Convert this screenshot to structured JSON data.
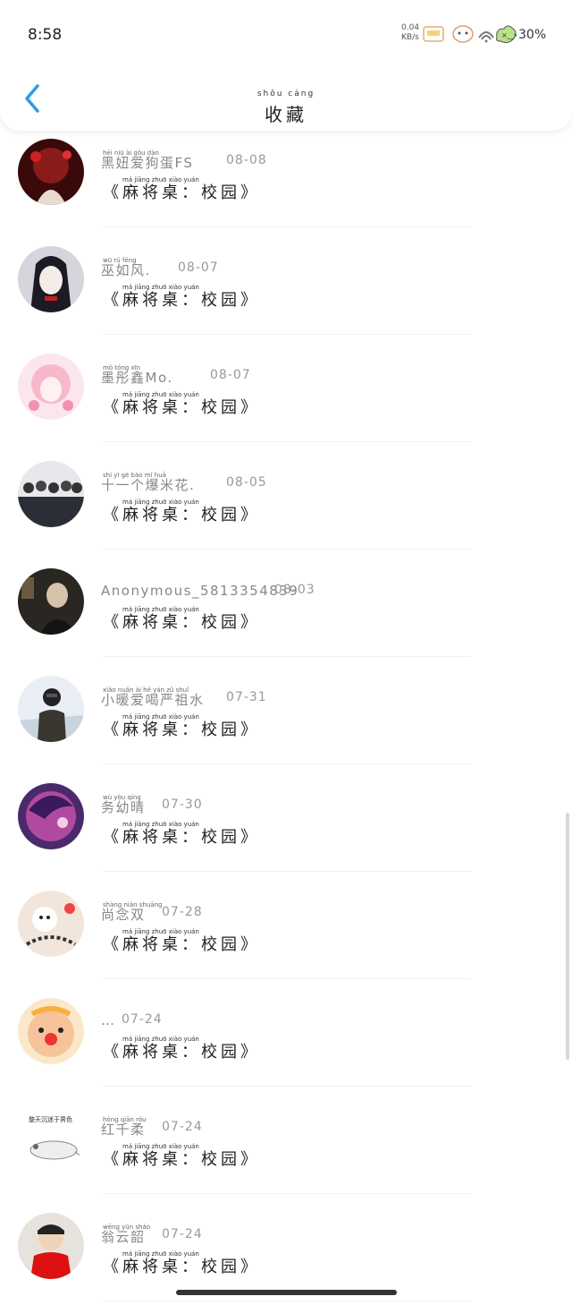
{
  "status_bar": {
    "time": "8:58",
    "net_speed_value": "0.04",
    "net_speed_unit": "KB/s",
    "battery": "30%"
  },
  "header": {
    "title": "收藏",
    "title_pinyin": "shōu cáng"
  },
  "items": [
    {
      "name": "黑妞爱狗蛋FS",
      "name_pinyin": "hēi niū ài gǒu dàn",
      "date": "08-08",
      "content": "《麻将桌：校园》"
    },
    {
      "name": "巫如风.",
      "name_pinyin": "wū rú fēng",
      "date": "08-07",
      "content": "《麻将桌：校园》"
    },
    {
      "name": "墨彤鑫Mo.",
      "name_pinyin": "mò tóng xīn",
      "date": "08-07",
      "content": "《麻将桌：校园》"
    },
    {
      "name": "十一个爆米花.",
      "name_pinyin": "shí yī gè bào mǐ huā",
      "date": "08-05",
      "content": "《麻将桌：校园》"
    },
    {
      "name": "Anonymous_5813354839",
      "name_pinyin": "",
      "date": "08-03",
      "content": "《麻将桌：校园》"
    },
    {
      "name": "小暖爱喝严祖水",
      "name_pinyin": "xiǎo nuǎn ài hē yán zǔ shuǐ",
      "date": "07-31",
      "content": "《麻将桌：校园》"
    },
    {
      "name": "务幼晴",
      "name_pinyin": "wù yòu qíng",
      "date": "07-30",
      "content": "《麻将桌：校园》"
    },
    {
      "name": "尚念双",
      "name_pinyin": "shàng niàn shuāng",
      "date": "07-28",
      "content": "《麻将桌：校园》"
    },
    {
      "name": "…",
      "name_pinyin": "",
      "date": "07-24",
      "content": "《麻将桌：校园》"
    },
    {
      "name": "红千柔",
      "name_pinyin": "hóng qiān róu",
      "date": "07-24",
      "content": "《麻将桌：校园》",
      "avatar_text": "整天沉迷于男色"
    },
    {
      "name": "翁云韶",
      "name_pinyin": "wēng yún sháo",
      "date": "07-24",
      "content": "《麻将桌：校园》"
    }
  ],
  "content_pinyin": "má jiāng zhuō      xiào yuán",
  "colors": {
    "accent": "#2a9bf0",
    "name_gray": "#888888",
    "date_gray": "#999999"
  },
  "icons": {
    "back": "chevron-left-icon",
    "battery": "cloud-battery-icon"
  }
}
